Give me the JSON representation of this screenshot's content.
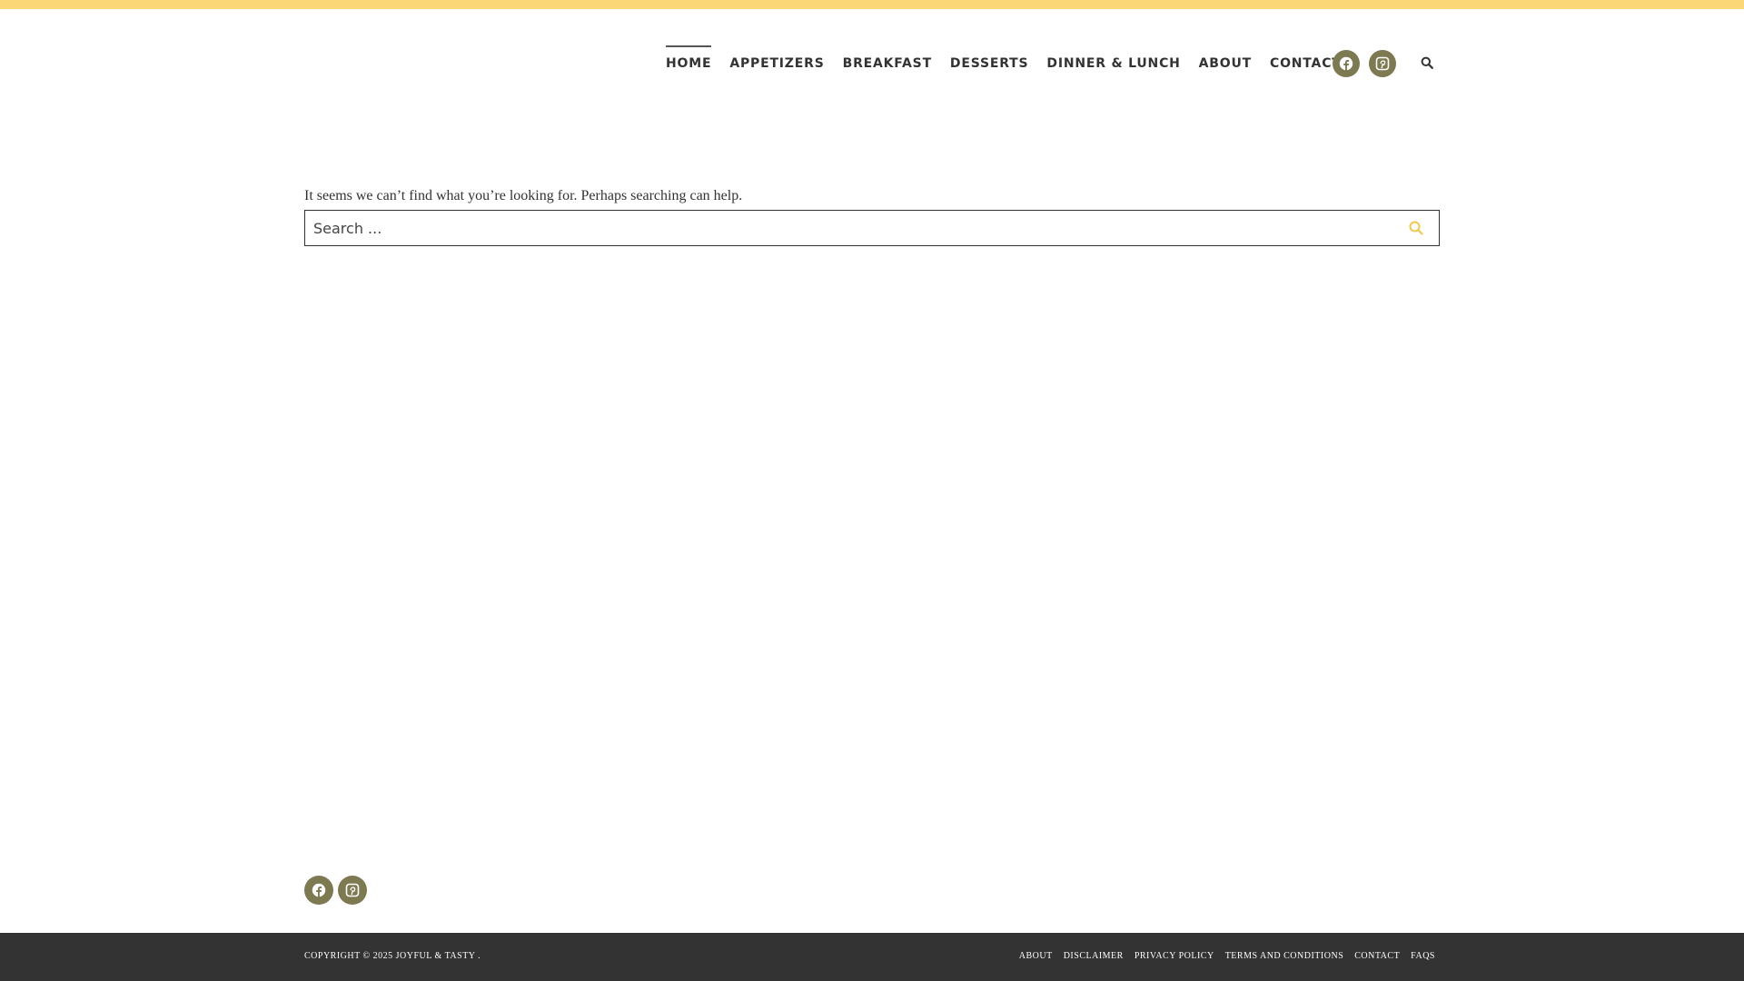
{
  "colors": {
    "accent_bar": "#fcd778",
    "social_bg": "#7d7a52",
    "search_icon": "#f2c84b",
    "footer_bg": "#333333"
  },
  "nav": {
    "items": [
      {
        "label": "HOME",
        "active": true
      },
      {
        "label": "APPETIZERS"
      },
      {
        "label": "BREAKFAST"
      },
      {
        "label": "DESSERTS"
      },
      {
        "label": "DINNER & LUNCH"
      },
      {
        "label": "ABOUT"
      },
      {
        "label": "CONTACT"
      }
    ],
    "social_icons": [
      "facebook-icon",
      "pinterest-icon"
    ],
    "search_icon": "search-icon"
  },
  "main": {
    "message": "It seems we can’t find what you’re looking for. Perhaps searching can help.",
    "search": {
      "placeholder": "Search ...",
      "value": ""
    }
  },
  "footer": {
    "social_icons": [
      "facebook-icon",
      "pinterest-icon"
    ],
    "copyright": "COPYRIGHT © 2025 JOYFUL & TASTY .",
    "links": [
      "ABOUT",
      "DISCLAIMER",
      "PRIVACY POLICY",
      "TERMS AND CONDITIONS",
      "CONTACT",
      "FAQS"
    ]
  }
}
